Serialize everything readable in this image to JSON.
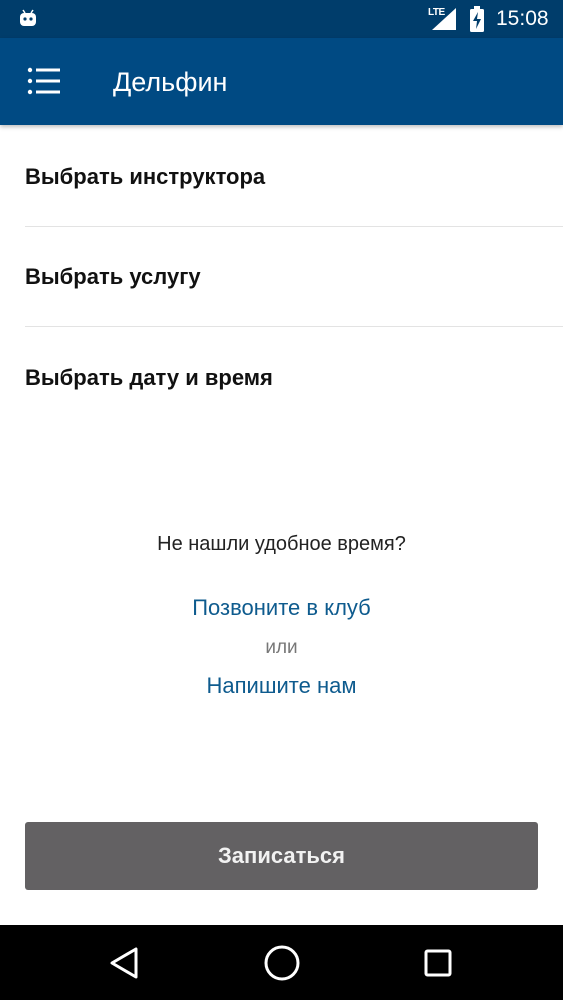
{
  "status_bar": {
    "network_label": "LTE",
    "time": "15:08",
    "icons": [
      "android-robot-icon",
      "signal-icon",
      "battery-charging-icon"
    ]
  },
  "app_bar": {
    "title": "Дельфин",
    "menu_icon": "list-menu-icon"
  },
  "options": [
    {
      "label": "Выбрать инструктора"
    },
    {
      "label": "Выбрать услугу"
    },
    {
      "label": "Выбрать дату и время"
    }
  ],
  "help": {
    "question": "Не нашли удобное время?",
    "call_link": "Позвоните в клуб",
    "or": "или",
    "write_link": "Напишите нам"
  },
  "submit_button": {
    "label": "Записаться"
  },
  "nav_bar": {
    "icons": [
      "back-icon",
      "home-icon",
      "recent-apps-icon"
    ]
  },
  "colors": {
    "status_bar": "#003d6b",
    "app_bar": "#004a83",
    "link": "#0e5b8e",
    "button": "#636163"
  }
}
